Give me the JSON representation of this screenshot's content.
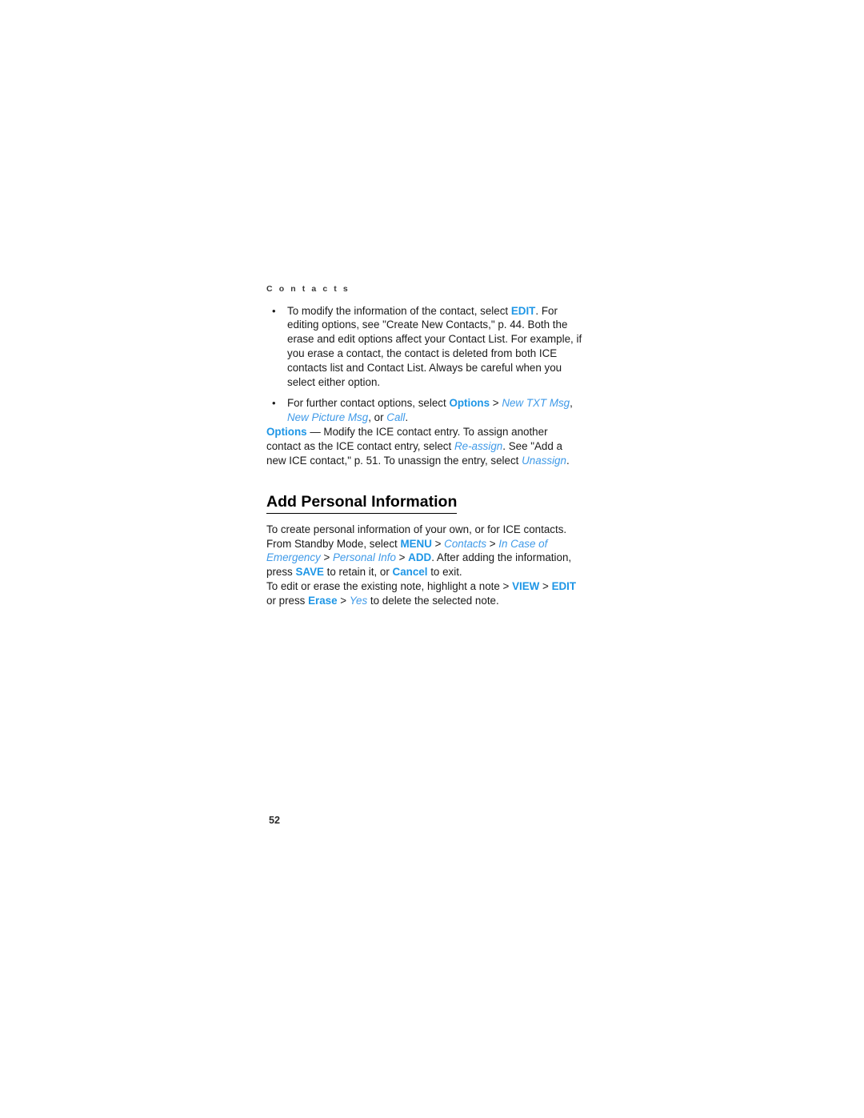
{
  "document": {
    "running_header": "C o n t a c t s",
    "running_header_plain": "Contacts",
    "page_number": "52",
    "accent_color": "#1e96e6",
    "accent_italic_color": "#3f9ae8",
    "text_color": "#1a1a1a"
  },
  "bullets": [
    {
      "seg1": "To modify the information of the contact, select ",
      "key1": "EDIT",
      "seg2": ". For editing options, see \"Create New Contacts,\" p. 44. Both the erase and edit options affect your Contact List. For example, if you erase a contact, the contact is deleted from both ICE contacts list and Contact List. Always be careful when you select either option."
    },
    {
      "seg1": "For further contact options, select ",
      "key1": "Options",
      "sep1": " > ",
      "item1": "New TXT Msg",
      "seg2": ", ",
      "item2": "New Picture Msg",
      "seg3": ", or ",
      "item3": "Call",
      "seg4": "."
    }
  ],
  "options_paragraph": {
    "key1": "Options",
    "seg1": " — Modify the ICE contact entry. To assign another contact as the ICE contact entry, select ",
    "item1": "Re-assign",
    "seg2": ". See \"Add a new ICE contact,\" p. 51. To unassign the entry, select ",
    "item2": "Unassign",
    "seg3": "."
  },
  "section": {
    "heading": "Add Personal Information",
    "intro": {
      "seg1": "To create personal information of your own, or for ICE contacts. From Standby Mode, select ",
      "key1": "MENU",
      "sep1": " > ",
      "item1": "Contacts",
      "sep2": " > ",
      "item2": "In Case of Emergency",
      "sep3": " > ",
      "item3": "Personal Info",
      "sep4": " > ",
      "key2": "ADD",
      "seg2": ". After adding the information, press ",
      "key3": "SAVE",
      "seg3": " to retain it, or ",
      "key4": "Cancel",
      "seg4": " to exit."
    },
    "edit_note": {
      "seg1": "To edit or erase the existing note, highlight a note > ",
      "key1": "VIEW",
      "sep1": " > ",
      "key2": "EDIT",
      "seg2": " or press ",
      "key3": "Erase",
      "sep2": " > ",
      "item1": "Yes",
      "seg3": " to delete the selected note."
    }
  }
}
